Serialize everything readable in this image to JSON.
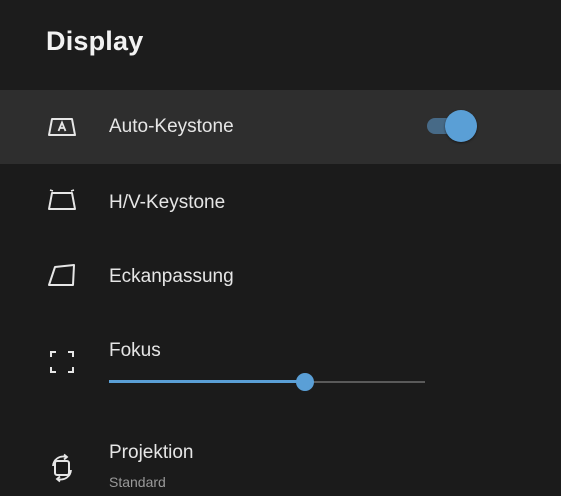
{
  "header": {
    "title": "Display"
  },
  "menu": {
    "auto_keystone": {
      "label": "Auto-Keystone",
      "icon": "keystone-a-icon",
      "toggle_on": true
    },
    "hv_keystone": {
      "label": "H/V-Keystone",
      "icon": "trapezoid-icon"
    },
    "corner_adjust": {
      "label": "Eckanpassung",
      "icon": "corner-quad-icon"
    },
    "focus": {
      "label": "Fokus",
      "icon": "focus-brackets-icon",
      "slider_value": 0.62
    },
    "projection": {
      "label": "Projektion",
      "value": "Standard",
      "icon": "rotate-screen-icon"
    }
  },
  "colors": {
    "background": "#1b1b1b",
    "selected_row": "#2e2e2e",
    "accent": "#5a9fd6",
    "toggle_track": "#476a87",
    "text": "#e6e6e6",
    "subtext": "#9a9a9a"
  }
}
